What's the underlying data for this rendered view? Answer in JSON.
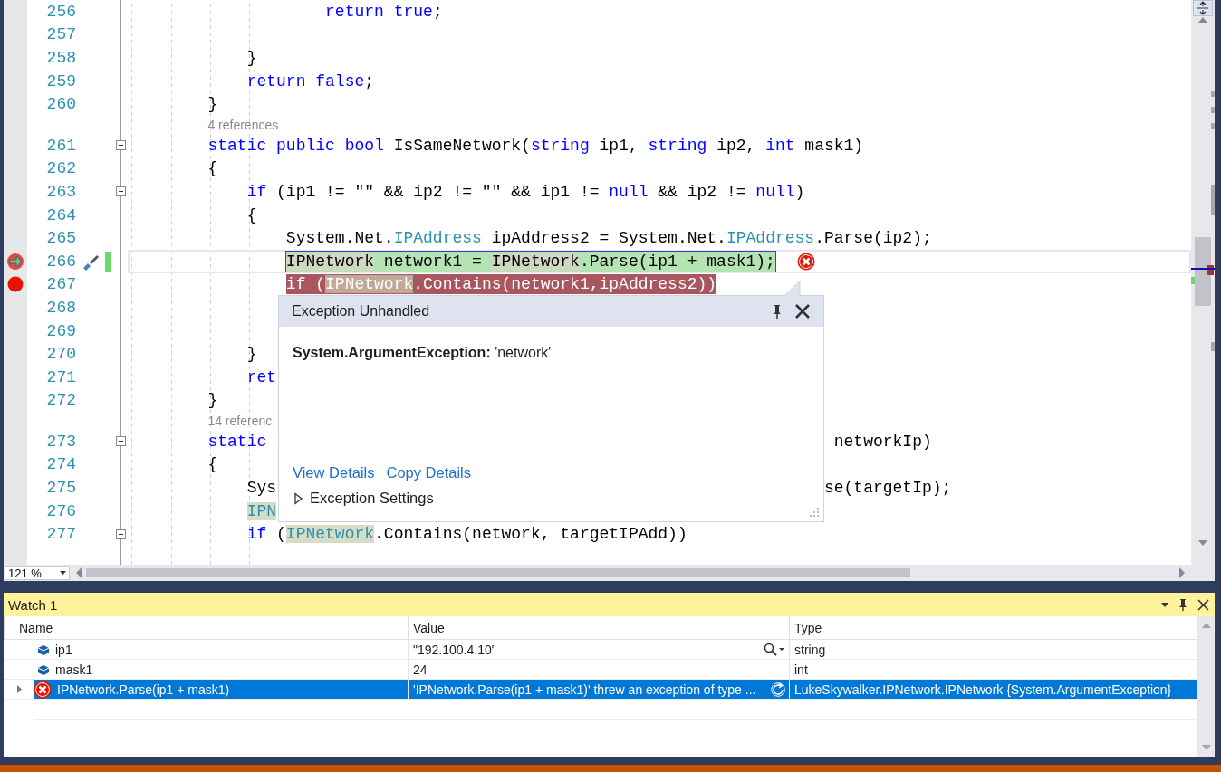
{
  "editor": {
    "lines": [
      {
        "kind": "code",
        "number": "256",
        "breakpoint": false,
        "current": false,
        "fold": false,
        "tokens": [
          {
            "kind": "keyword",
            "text": "                    return true"
          },
          {
            "kind": "plain",
            "text": ";"
          }
        ]
      },
      {
        "kind": "code",
        "number": "257",
        "breakpoint": false,
        "current": false,
        "fold": false
      },
      {
        "kind": "code",
        "number": "258",
        "breakpoint": false,
        "current": false,
        "fold": false,
        "tokens": [
          {
            "kind": "plain",
            "text": "            }"
          }
        ]
      },
      {
        "kind": "code",
        "number": "259",
        "breakpoint": false,
        "current": false,
        "fold": false,
        "tokens": [
          {
            "kind": "keyword",
            "text": "            return false"
          },
          {
            "kind": "plain",
            "text": ";"
          }
        ]
      },
      {
        "kind": "code",
        "number": "260",
        "breakpoint": false,
        "current": false,
        "fold": false,
        "tokens": [
          {
            "kind": "plain",
            "text": "        }"
          }
        ]
      },
      {
        "kind": "lens",
        "text": "4 references"
      },
      {
        "kind": "code",
        "number": "261",
        "breakpoint": false,
        "current": false,
        "fold": true,
        "tokens": [
          {
            "kind": "keyword",
            "text": "        static public bool"
          },
          {
            "kind": "plain",
            "text": " IsSameNetwork("
          },
          {
            "kind": "keyword",
            "text": "string"
          },
          {
            "kind": "plain",
            "text": " ip1, "
          },
          {
            "kind": "keyword",
            "text": "string"
          },
          {
            "kind": "plain",
            "text": " ip2, "
          },
          {
            "kind": "keyword",
            "text": "int"
          },
          {
            "kind": "plain",
            "text": " mask1)"
          }
        ]
      },
      {
        "kind": "code",
        "number": "262",
        "breakpoint": false,
        "current": false,
        "fold": false,
        "tokens": [
          {
            "kind": "plain",
            "text": "        {"
          }
        ]
      },
      {
        "kind": "code",
        "number": "263",
        "breakpoint": false,
        "current": false,
        "fold": true,
        "tokens": [
          {
            "kind": "keyword",
            "text": "            if"
          },
          {
            "kind": "plain",
            "text": " (ip1 != \"\" && ip2 != \"\" && ip1 != "
          },
          {
            "kind": "keyword",
            "text": "null"
          },
          {
            "kind": "plain",
            "text": " && ip2 != "
          },
          {
            "kind": "keyword",
            "text": "null"
          },
          {
            "kind": "plain",
            "text": ")"
          }
        ]
      },
      {
        "kind": "code",
        "number": "264",
        "breakpoint": false,
        "current": false,
        "fold": false,
        "tokens": [
          {
            "kind": "plain",
            "text": "            {"
          }
        ]
      },
      {
        "kind": "code",
        "number": "265",
        "breakpoint": false,
        "current": false,
        "fold": false,
        "tokens": [
          {
            "kind": "plain",
            "text": "                System.Net."
          },
          {
            "kind": "type",
            "text": "IPAddress"
          },
          {
            "kind": "plain",
            "text": " ipAddress2 = System.Net."
          },
          {
            "kind": "type",
            "text": "IPAddress"
          },
          {
            "kind": "plain",
            "text": ".Parse(ip2);"
          }
        ]
      },
      {
        "kind": "code",
        "number": "266",
        "breakpoint": false,
        "current": true,
        "fold": false,
        "error": true,
        "tokens": [
          {
            "kind": "type",
            "text": "                IPNetwork",
            "ref": true
          },
          {
            "kind": "plain",
            "text": " network1 = "
          },
          {
            "kind": "type",
            "text": "IPNetwork",
            "ref": true
          },
          {
            "kind": "plain",
            "text": ".Parse(ip1 + mask1);"
          }
        ]
      },
      {
        "kind": "code",
        "number": "267",
        "breakpoint": true,
        "current": false,
        "fold": false,
        "tokens": [
          {
            "kind": "keyword",
            "text": "                if"
          },
          {
            "kind": "plain",
            "text": " ("
          },
          {
            "kind": "type",
            "text": "IPNetwork",
            "ref": true
          },
          {
            "kind": "plain",
            "text": ".Contains(network1,ipAddress2))"
          }
        ]
      },
      {
        "kind": "code",
        "number": "268",
        "breakpoint": false,
        "current": false,
        "fold": false
      },
      {
        "kind": "code",
        "number": "269",
        "breakpoint": false,
        "current": false,
        "fold": false
      },
      {
        "kind": "code",
        "number": "270",
        "breakpoint": false,
        "current": false,
        "fold": false,
        "tokens": [
          {
            "kind": "plain",
            "text": "            }"
          }
        ]
      },
      {
        "kind": "code",
        "number": "271",
        "breakpoint": false,
        "current": false,
        "fold": false,
        "tokens": [
          {
            "kind": "keyword",
            "text": "            ret"
          }
        ]
      },
      {
        "kind": "code",
        "number": "272",
        "breakpoint": false,
        "current": false,
        "fold": false,
        "tokens": [
          {
            "kind": "plain",
            "text": "        }"
          }
        ]
      },
      {
        "kind": "lens",
        "text": "14 referenc"
      },
      {
        "kind": "code",
        "number": "273",
        "breakpoint": false,
        "current": false,
        "fold": true,
        "tokens": [
          {
            "kind": "keyword",
            "text": "        static"
          },
          {
            "kind": "plain",
            "text": "                                                          networkIp)"
          }
        ]
      },
      {
        "kind": "code",
        "number": "274",
        "breakpoint": false,
        "current": false,
        "fold": false,
        "tokens": [
          {
            "kind": "plain",
            "text": "        {"
          }
        ]
      },
      {
        "kind": "code",
        "number": "275",
        "breakpoint": false,
        "current": false,
        "fold": false,
        "tokens": [
          {
            "kind": "plain",
            "text": "            Sys"
          },
          {
            "kind": "plain",
            "text": "                                                        se(targetIp);"
          }
        ]
      },
      {
        "kind": "code",
        "number": "276",
        "breakpoint": false,
        "current": false,
        "fold": false,
        "tokens": [
          {
            "kind": "type",
            "text": "            IPN",
            "ref": true
          }
        ]
      },
      {
        "kind": "code",
        "number": "277",
        "breakpoint": false,
        "current": false,
        "fold": true,
        "tokens": [
          {
            "kind": "keyword",
            "text": "            if"
          },
          {
            "kind": "plain",
            "text": " ("
          },
          {
            "kind": "type",
            "text": "IPNetwork",
            "ref": true
          },
          {
            "kind": "plain",
            "text": ".Contains(network, targetIPAdd))"
          }
        ]
      }
    ],
    "zoom": "121 %",
    "popup": {
      "title": "Exception Unhandled",
      "message": "**System.ArgumentException:** 'network'",
      "links": [
        "View Details",
        "Copy Details"
      ],
      "settings": {
        "label": "Exception Settings",
        "expanded": false
      }
    }
  },
  "watch": {
    "title": "Watch 1",
    "columns": [
      "Name",
      "Value",
      "Type"
    ],
    "rows": [
      {
        "kind": "variable",
        "name": "ip1",
        "value": "\"192.100.4.10\"",
        "type": "string",
        "visualizer": true,
        "selected": false
      },
      {
        "kind": "variable",
        "name": "mask1",
        "value": "24",
        "type": "int",
        "visualizer": false,
        "selected": false
      },
      {
        "kind": "exception",
        "name": "IPNetwork.Parse(ip1 + mask1)",
        "value": "'IPNetwork.Parse(ip1 + mask1)' threw an exception of type ...",
        "type": "LukeSkywalker.IPNetwork.IPNetwork {System.ArgumentException}",
        "visualizer": false,
        "selected": true
      }
    ]
  }
}
